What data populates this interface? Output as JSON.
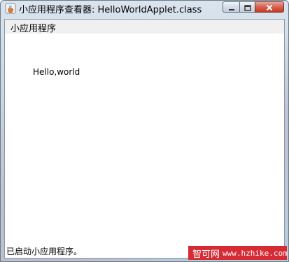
{
  "window": {
    "title": "小应用程序查看器: HelloWorldApplet.class"
  },
  "menu": {
    "items": [
      {
        "label": "小应用程序"
      }
    ]
  },
  "applet": {
    "text": "Hello,world"
  },
  "status": {
    "text": "已启动小应用程序。"
  },
  "watermark": {
    "cn": "智可网",
    "url": "www.hzhike.com"
  },
  "icons": {
    "app": "java-cup-icon",
    "minimize": "minimize-icon",
    "maximize": "maximize-icon",
    "close": "close-icon"
  },
  "colors": {
    "close_button": "#c43a26",
    "watermark_bg": "#d62b34"
  }
}
